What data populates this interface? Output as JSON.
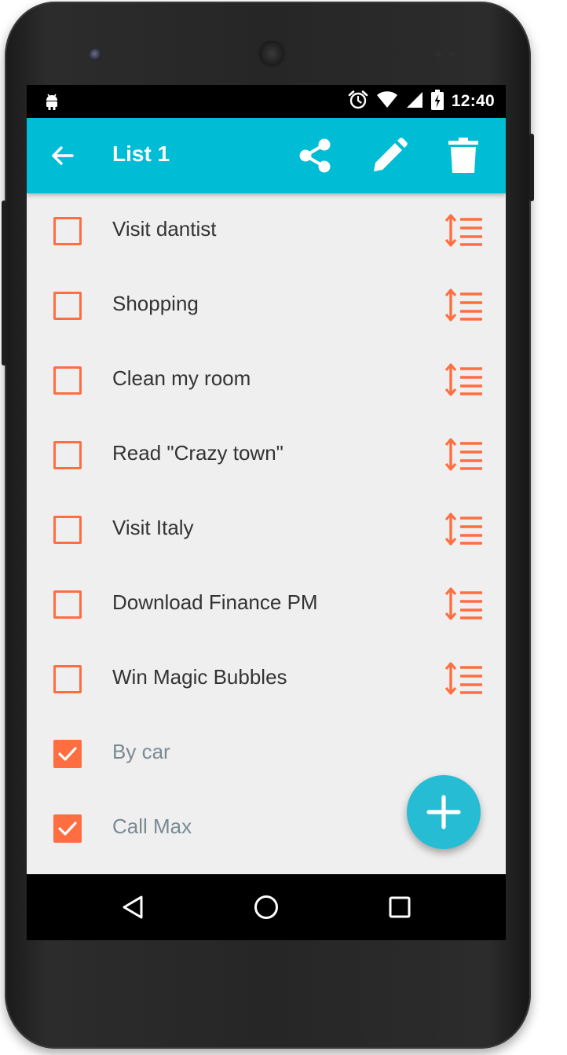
{
  "status_bar": {
    "time": "12:40",
    "icons": [
      "android-debug-icon",
      "alarm-icon",
      "wifi-icon",
      "signal-icon",
      "battery-icon"
    ]
  },
  "app_bar": {
    "title": "List 1",
    "back_icon": "arrow-back-icon",
    "actions": [
      "share-icon",
      "edit-icon",
      "delete-icon"
    ]
  },
  "items": [
    {
      "label": "Visit dantist",
      "checked": false
    },
    {
      "label": "Shopping",
      "checked": false
    },
    {
      "label": "Clean my room",
      "checked": false
    },
    {
      "label": "Read \"Crazy town\"",
      "checked": false
    },
    {
      "label": "Visit Italy",
      "checked": false
    },
    {
      "label": "Download Finance PM",
      "checked": false
    },
    {
      "label": "Win Magic Bubbles",
      "checked": false
    },
    {
      "label": "By car",
      "checked": true
    },
    {
      "label": "Call Max",
      "checked": true
    }
  ],
  "fab": {
    "icon": "plus-icon"
  },
  "nav_bar": [
    "back-triangle-icon",
    "home-circle-icon",
    "recents-square-icon"
  ],
  "colors": {
    "primary": "#00bcd4",
    "accent": "#ff6e40",
    "fab": "#26bcd3",
    "checked_text": "#7a8a93"
  }
}
